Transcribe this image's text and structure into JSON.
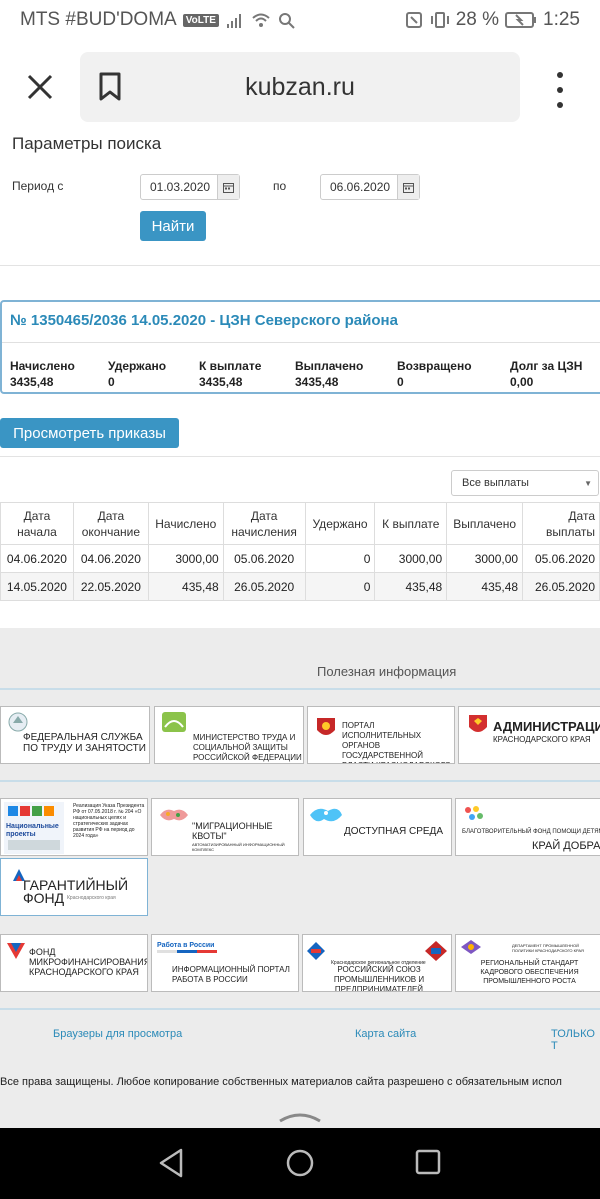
{
  "status_bar": {
    "carrier": "MTS #BUD'DOMA",
    "volte": "VoLTE",
    "battery": "28 %",
    "time": "1:25"
  },
  "browser": {
    "url": "kubzan.ru"
  },
  "search": {
    "title": "Параметры поиска",
    "period_label": "Период с",
    "date_from": "01.03.2020",
    "to_label": "по",
    "date_to": "06.06.2020",
    "find_button": "Найти"
  },
  "record": {
    "title": "№ 1350465/2036 14.05.2020 - ЦЗН Северского района",
    "columns": [
      {
        "label": "Начислено",
        "value": "3435,48"
      },
      {
        "label": "Удержано",
        "value": "0"
      },
      {
        "label": "К выплате",
        "value": "3435,48"
      },
      {
        "label": "Выплачено",
        "value": "3435,48"
      },
      {
        "label": "Возвращено",
        "value": "0"
      },
      {
        "label": "Долг за ЦЗН",
        "value": "0,00"
      }
    ]
  },
  "orders_button": "Просмотреть приказы",
  "filter_select": "Все выплаты",
  "table": {
    "headers": [
      "Дата начала",
      "Дата окончание",
      "Начислено",
      "Дата начисления",
      "Удержано",
      "К выплате",
      "Выплачено",
      "Дата выплаты"
    ],
    "rows": [
      [
        "04.06.2020",
        "04.06.2020",
        "3000,00",
        "05.06.2020",
        "0",
        "3000,00",
        "3000,00",
        "05.06.2020"
      ],
      [
        "14.05.2020",
        "22.05.2020",
        "435,48",
        "26.05.2020",
        "0",
        "435,48",
        "435,48",
        "26.05.2020"
      ]
    ]
  },
  "useful": {
    "title": "Полезная информация",
    "banners_row1": [
      "ФЕДЕРАЛЬНАЯ СЛУЖБА ПО ТРУДУ И ЗАНЯТОСТИ",
      "МИНИСТЕРСТВО ТРУДА И СОЦИАЛЬНОЙ ЗАЩИТЫ РОССИЙСКОЙ ФЕДЕРАЦИИ",
      "ПОРТАЛ ИСПОЛНИТЕЛЬНЫХ ОРГАНОВ ГОСУДАРСТВЕННОЙ ВЛАСТИ КРАСНОДАРСКОГО КРАЯ",
      "АДМИНИСТРАЦИЯ",
      "КРАСНОДАРСКОГО КРАЯ"
    ],
    "banners_row2": [
      "Национальные проекты",
      "Реализация Указа Президента РФ от 07.05.2018 г. № 204 «О национальных целях и стратегических задачах развития РФ на период до 2024 года»",
      "\"МИГРАЦИОННЫЕ КВОТЫ\"",
      "АВТОМАТИЗИРОВАННЫЙ ИНФОРМАЦИОННЫЙ КОМПЛЕКС",
      "ДОСТУПНАЯ СРЕДА",
      "БЛАГОТВОРИТЕЛЬНЫЙ ФОНД ПОМОЩИ ДЕТЯМ",
      "КРАЙ ДОБРА"
    ],
    "banner_fund": "ГАРАНТИЙНЫЙ ФОНД",
    "banner_fund_sub": "Краснодарского края",
    "banners_row4": [
      "ФОНД МИКРОФИНАНСИРОВАНИЯ КРАСНОДАРСКОГО КРАЯ",
      "Работа в России",
      "ИНФОРМАЦИОННЫЙ ПОРТАЛ РАБОТА В РОССИИ",
      "Краснодарское региональное отделение",
      "РОССИЙСКИЙ СОЮЗ ПРОМЫШЛЕННИКОВ И ПРЕДПРИНИМАТЕЛЕЙ",
      "ДЕПАРТАМЕНТ ПРОМЫШЛЕННОЙ ПОЛИТИКИ КРАСНОДАРСКОГО КРАЯ",
      "РЕГИОНАЛЬНЫЙ СТАНДАРТ КАДРОВОГО ОБЕСПЕЧЕНИЯ ПРОМЫШЛЕННОГО РОСТА"
    ]
  },
  "footer": {
    "links": [
      "Браузеры для просмотра",
      "Карта сайта",
      "ТОЛЬКО Т"
    ],
    "copyright": "Все права защищены. Любое копирование собственных материалов сайта разрешено с обязательным испол"
  },
  "icons": {
    "accent": "#3a95c4",
    "title_color": "#2b8ab8"
  }
}
